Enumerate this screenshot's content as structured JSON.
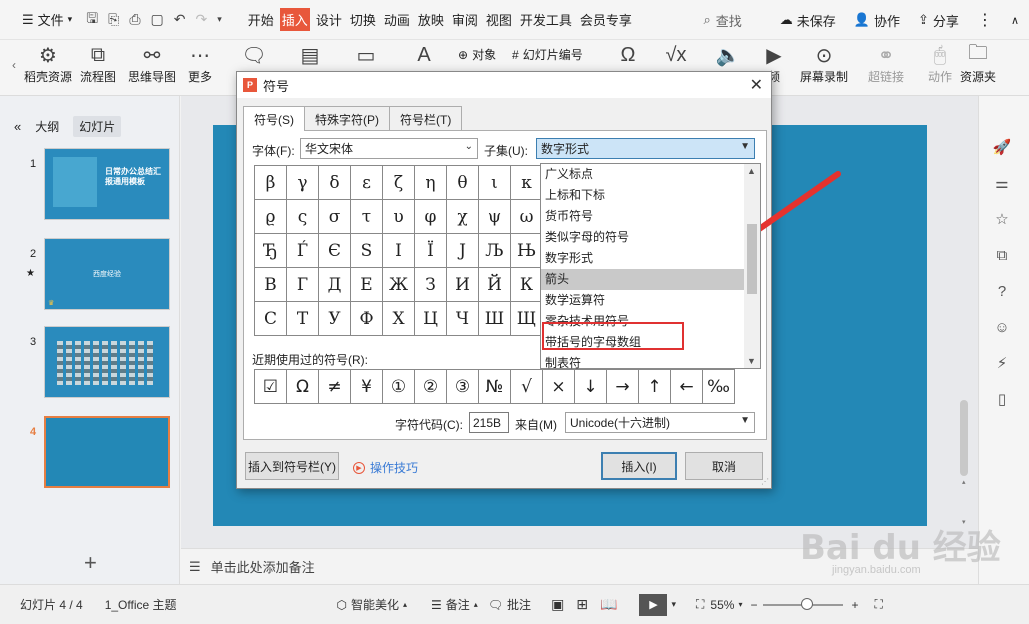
{
  "menubar": {
    "file": "文件",
    "tabs": [
      "开始",
      "插入",
      "设计",
      "切换",
      "动画",
      "放映",
      "审阅",
      "视图",
      "开发工具",
      "会员专享"
    ],
    "active_tab_index": 1,
    "search": "查找",
    "unsaved": "未保存",
    "collab": "协作",
    "share": "分享"
  },
  "ribbon": {
    "items_left": [
      "稻壳资源",
      "流程图",
      "思维导图",
      "更多"
    ],
    "object": "对象",
    "slide_number": "幻灯片编号",
    "items_right": [
      "频",
      "屏幕录制",
      "超链接",
      "动作",
      "资源夹"
    ]
  },
  "left_panel": {
    "tabs": [
      "大纲",
      "幻灯片"
    ],
    "slides": [
      {
        "num": "1",
        "text": "日常办公总结汇报通用模板"
      },
      {
        "num": "2",
        "text": "西度经验"
      },
      {
        "num": "3",
        "text": ""
      },
      {
        "num": "4",
        "text": ""
      }
    ],
    "add": "+"
  },
  "notes": "单击此处添加备注",
  "statusbar": {
    "slide_info": "幻灯片 4 / 4",
    "theme": "1_Office 主题",
    "beautify": "智能美化",
    "notes": "备注",
    "comment": "批注",
    "zoom": "55%",
    "zoom_level": 0.55
  },
  "dialog": {
    "title": "符号",
    "tabs": [
      "符号(S)",
      "特殊字符(P)",
      "符号栏(T)"
    ],
    "font_label": "字体(F):",
    "font_value": "华文宋体",
    "subset_label": "子集(U):",
    "subset_value": "数字形式",
    "symbols": [
      [
        "β",
        "γ",
        "δ",
        "ε",
        "ζ",
        "η",
        "θ",
        "ι",
        "κ"
      ],
      [
        "ϱ",
        "ς",
        "σ",
        "τ",
        "υ",
        "φ",
        "χ",
        "ψ",
        "ω"
      ],
      [
        "Ђ",
        "Ѓ",
        "Є",
        "Ѕ",
        "І",
        "Ї",
        "Ј",
        "Љ",
        "Њ"
      ],
      [
        "В",
        "Г",
        "Д",
        "Е",
        "Ж",
        "З",
        "И",
        "Й",
        "К"
      ],
      [
        "С",
        "Т",
        "У",
        "Ф",
        "Х",
        "Ц",
        "Ч",
        "Ш",
        "Щ"
      ]
    ],
    "dropdown_items": [
      "广义标点",
      "上标和下标",
      "货币符号",
      "类似字母的符号",
      "数字形式",
      "箭头",
      "数学运算符",
      "零杂技术用符号",
      "带括号的字母数组",
      "制表符"
    ],
    "dropdown_highlight_index": 5,
    "recent_label": "近期使用过的符号(R):",
    "recent": [
      "☑",
      "Ω",
      "≠",
      "¥",
      "①",
      "②",
      "③",
      "№",
      "√",
      "×",
      "↓",
      "→",
      "↑",
      "←",
      "‰"
    ],
    "code_label": "字符代码(C):",
    "code_value": "215B",
    "from_label": "来自(M)",
    "from_value": "Unicode(十六进制)",
    "insert_to_bar": "插入到符号栏(Y)",
    "tips": "操作技巧",
    "insert": "插入(I)",
    "cancel": "取消"
  },
  "watermark": {
    "main": "Bai du 经验",
    "sub": "jingyan.baidu.com"
  },
  "colors": {
    "accent": "#e8573b",
    "slide_bg": "#2388b6",
    "highlight_red": "#e03131",
    "selection_orange": "#e67e42"
  }
}
